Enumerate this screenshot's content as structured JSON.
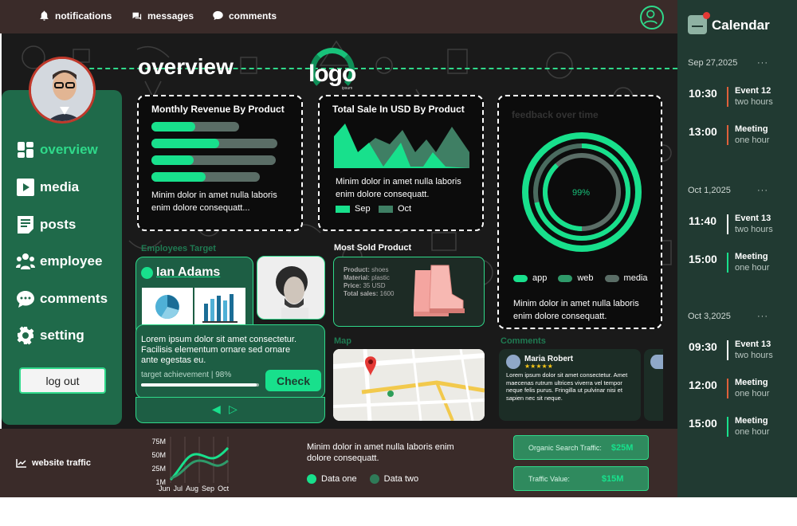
{
  "topbar": {
    "notifications": "notifications",
    "messages": "messages",
    "comments": "comments"
  },
  "logo": {
    "text": "logo",
    "sub": "ipsum"
  },
  "page_title": "overview",
  "sidebar": {
    "items": [
      {
        "label": "overview",
        "icon": "grid-icon"
      },
      {
        "label": "media",
        "icon": "play-icon"
      },
      {
        "label": "posts",
        "icon": "document-icon"
      },
      {
        "label": "employee",
        "icon": "people-icon"
      },
      {
        "label": "comments",
        "icon": "chat-icon"
      },
      {
        "label": "setting",
        "icon": "gear-icon"
      }
    ],
    "logout": "log out"
  },
  "revenue_card": {
    "title": "Monthly Revenue By Product",
    "bars": [
      0.5,
      0.54,
      0.34,
      0.5
    ],
    "text": "Minim dolor in amet nulla laboris enim dolore consequatt..."
  },
  "sales_card": {
    "title": "Total Sale In USD By Product",
    "text": "Minim dolor in amet nulla laboris enim dolore consequatt.",
    "legend": [
      "Sep",
      "Oct"
    ]
  },
  "feedback_card": {
    "title": "feedback over time",
    "center": "99%",
    "legend": [
      "app",
      "web",
      "media"
    ],
    "text": "Minim dolor in amet nulla laboris enim dolore consequatt."
  },
  "employee": {
    "section": "Employees Target",
    "name": "Ian Adams",
    "text": "Lorem ipsum dolor sit amet consectetur. Facilisis elementum ornare sed ornare ante egestas eu.",
    "target_label": "target achievement | 98%",
    "progress": 0.98,
    "button": "Check"
  },
  "most_sold": {
    "title": "Most Sold Product",
    "product_label": "Product:",
    "product": "shoes",
    "material_label": "Material:",
    "material": "plastic",
    "price_label": "Price:",
    "price": "35 USD",
    "sales_label": "Total sales:",
    "sales": "1600"
  },
  "map": {
    "label": "Map"
  },
  "comments": {
    "label": "Comments",
    "author": "Maria Robert",
    "stars": "★★★★★",
    "text": "Lorem ipsum dolor sit amet consectetur. Amet maecenas rutrum ultrices viverra vel tempor neque felis purus. Fringilla ut pulvinar nisi et sapien nec sit neque."
  },
  "bottom": {
    "traffic_label": "website traffic",
    "y_ticks": [
      "75M",
      "50M",
      "25M",
      "1M"
    ],
    "x_ticks": [
      "Jun",
      "Jul",
      "Aug",
      "Sep",
      "Oct"
    ],
    "text": "Minim dolor in amet nulla laboris enim dolore consequatt.",
    "legend": [
      "Data one",
      "Data two"
    ],
    "organic_label": "Organic Search Traffic:",
    "organic_value": "$25M",
    "traffic_value_label": "Traffic Value:",
    "traffic_value": "$15M"
  },
  "calendar": {
    "title": "Calendar",
    "days": [
      {
        "date": "Sep 27,2025",
        "events": [
          {
            "time": "10:30",
            "name": "Event 12",
            "dur": "two hours",
            "color": "#e0603a"
          },
          {
            "time": "13:00",
            "name": "Meeting",
            "dur": "one hour",
            "color": "#e0603a"
          }
        ]
      },
      {
        "date": "Oct 1,2025",
        "events": [
          {
            "time": "11:40",
            "name": "Event 13",
            "dur": "two hours",
            "color": "#ffffff"
          },
          {
            "time": "15:00",
            "name": "Meeting",
            "dur": "one hour",
            "color": "#18e08c"
          }
        ]
      },
      {
        "date": "Oct 3,2025",
        "events": [
          {
            "time": "09:30",
            "name": "Event 13",
            "dur": "two hours",
            "color": "#ffffff"
          },
          {
            "time": "12:00",
            "name": "Meeting",
            "dur": "one hour",
            "color": "#e0603a"
          },
          {
            "time": "15:00",
            "name": "Meeting",
            "dur": "one hour",
            "color": "#18e08c"
          }
        ]
      }
    ],
    "dots": "···"
  },
  "colors": {
    "accent": "#18e08c",
    "sidebar": "#1f6a4a",
    "bar": "#3a2b29",
    "calendar": "#213a32"
  }
}
